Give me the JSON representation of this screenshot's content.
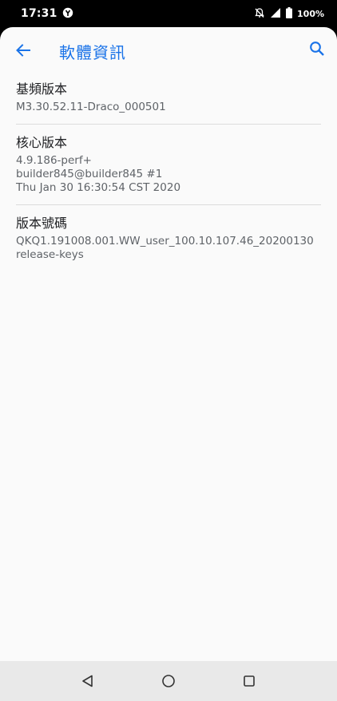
{
  "status_bar": {
    "time": "17:31",
    "battery": "100%"
  },
  "app_bar": {
    "title": "軟體資訊"
  },
  "items": [
    {
      "title": "基頻版本",
      "lines": [
        "M3.30.52.11-Draco_000501"
      ]
    },
    {
      "title": "核心版本",
      "lines": [
        "4.9.186-perf+",
        "builder845@builder845 #1",
        "Thu Jan 30 16:30:54 CST 2020"
      ]
    },
    {
      "title": "版本號碼",
      "lines": [
        "QKQ1.191008.001.WW_user_100.10.107.46_20200130",
        "release-keys"
      ]
    }
  ],
  "colors": {
    "accent": "#1a73e8",
    "background": "#fafafa"
  }
}
